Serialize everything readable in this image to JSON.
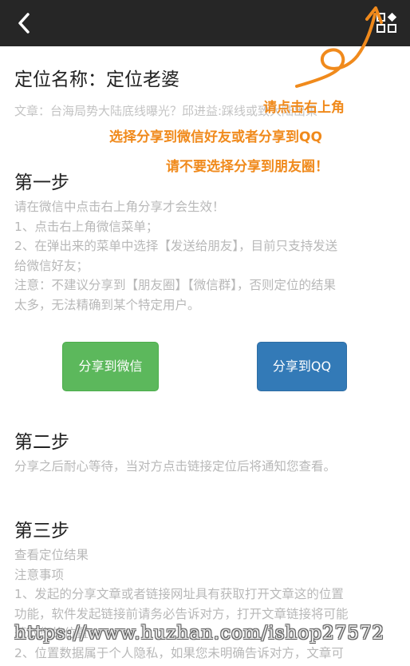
{
  "header": {
    "back_icon": "chevron-left-icon",
    "menu_icon": "grid-share-icon",
    "bg_color": "#262626"
  },
  "title": "定位名称：定位老婆",
  "article": "文章：台海局势大陆底线曝光？邱进益:踩线或致大陆出果",
  "hints": {
    "line1": "请点击右上角",
    "line2": "选择分享到微信好友或者分享到QQ",
    "line3": "请不要选择分享到朋友圈！",
    "color": "#f08a1c"
  },
  "step1": {
    "title": "第一步",
    "lines": [
      "请在微信中点击右上角分享才会生效！",
      "1、点击右上角微信菜单；",
      "2、在弹出来的菜单中选择【发送给朋友】，目前只支持发送",
      "给微信好友；",
      "注意：不建议分享到【朋友圈】【微信群】，否则定位的结果",
      "太多，无法精确到某个特定用户。"
    ]
  },
  "buttons": {
    "wechat_label": "分享到微信",
    "qq_label": "分享到QQ",
    "wechat_color": "#5cb85c",
    "qq_color": "#337ab7"
  },
  "step2": {
    "title": "第二步",
    "lines": [
      "分享之后耐心等待，当对方点击链接定位后将通知您查看。"
    ]
  },
  "step3": {
    "title": "第三步",
    "lines": [
      "查看定位结果",
      "注意事项",
      "1、发起的分享文章或者链接网址具有获取打开文章这的位置",
      "功能，软件发起链接前请务必告诉对方，打开文章链接将可能",
      "获取您的位置；",
      "2、位置数据属于个人隐私，如果您未明确告诉对方，文章可"
    ]
  },
  "watermark": "https://www.huzhan.com/ishop27572"
}
